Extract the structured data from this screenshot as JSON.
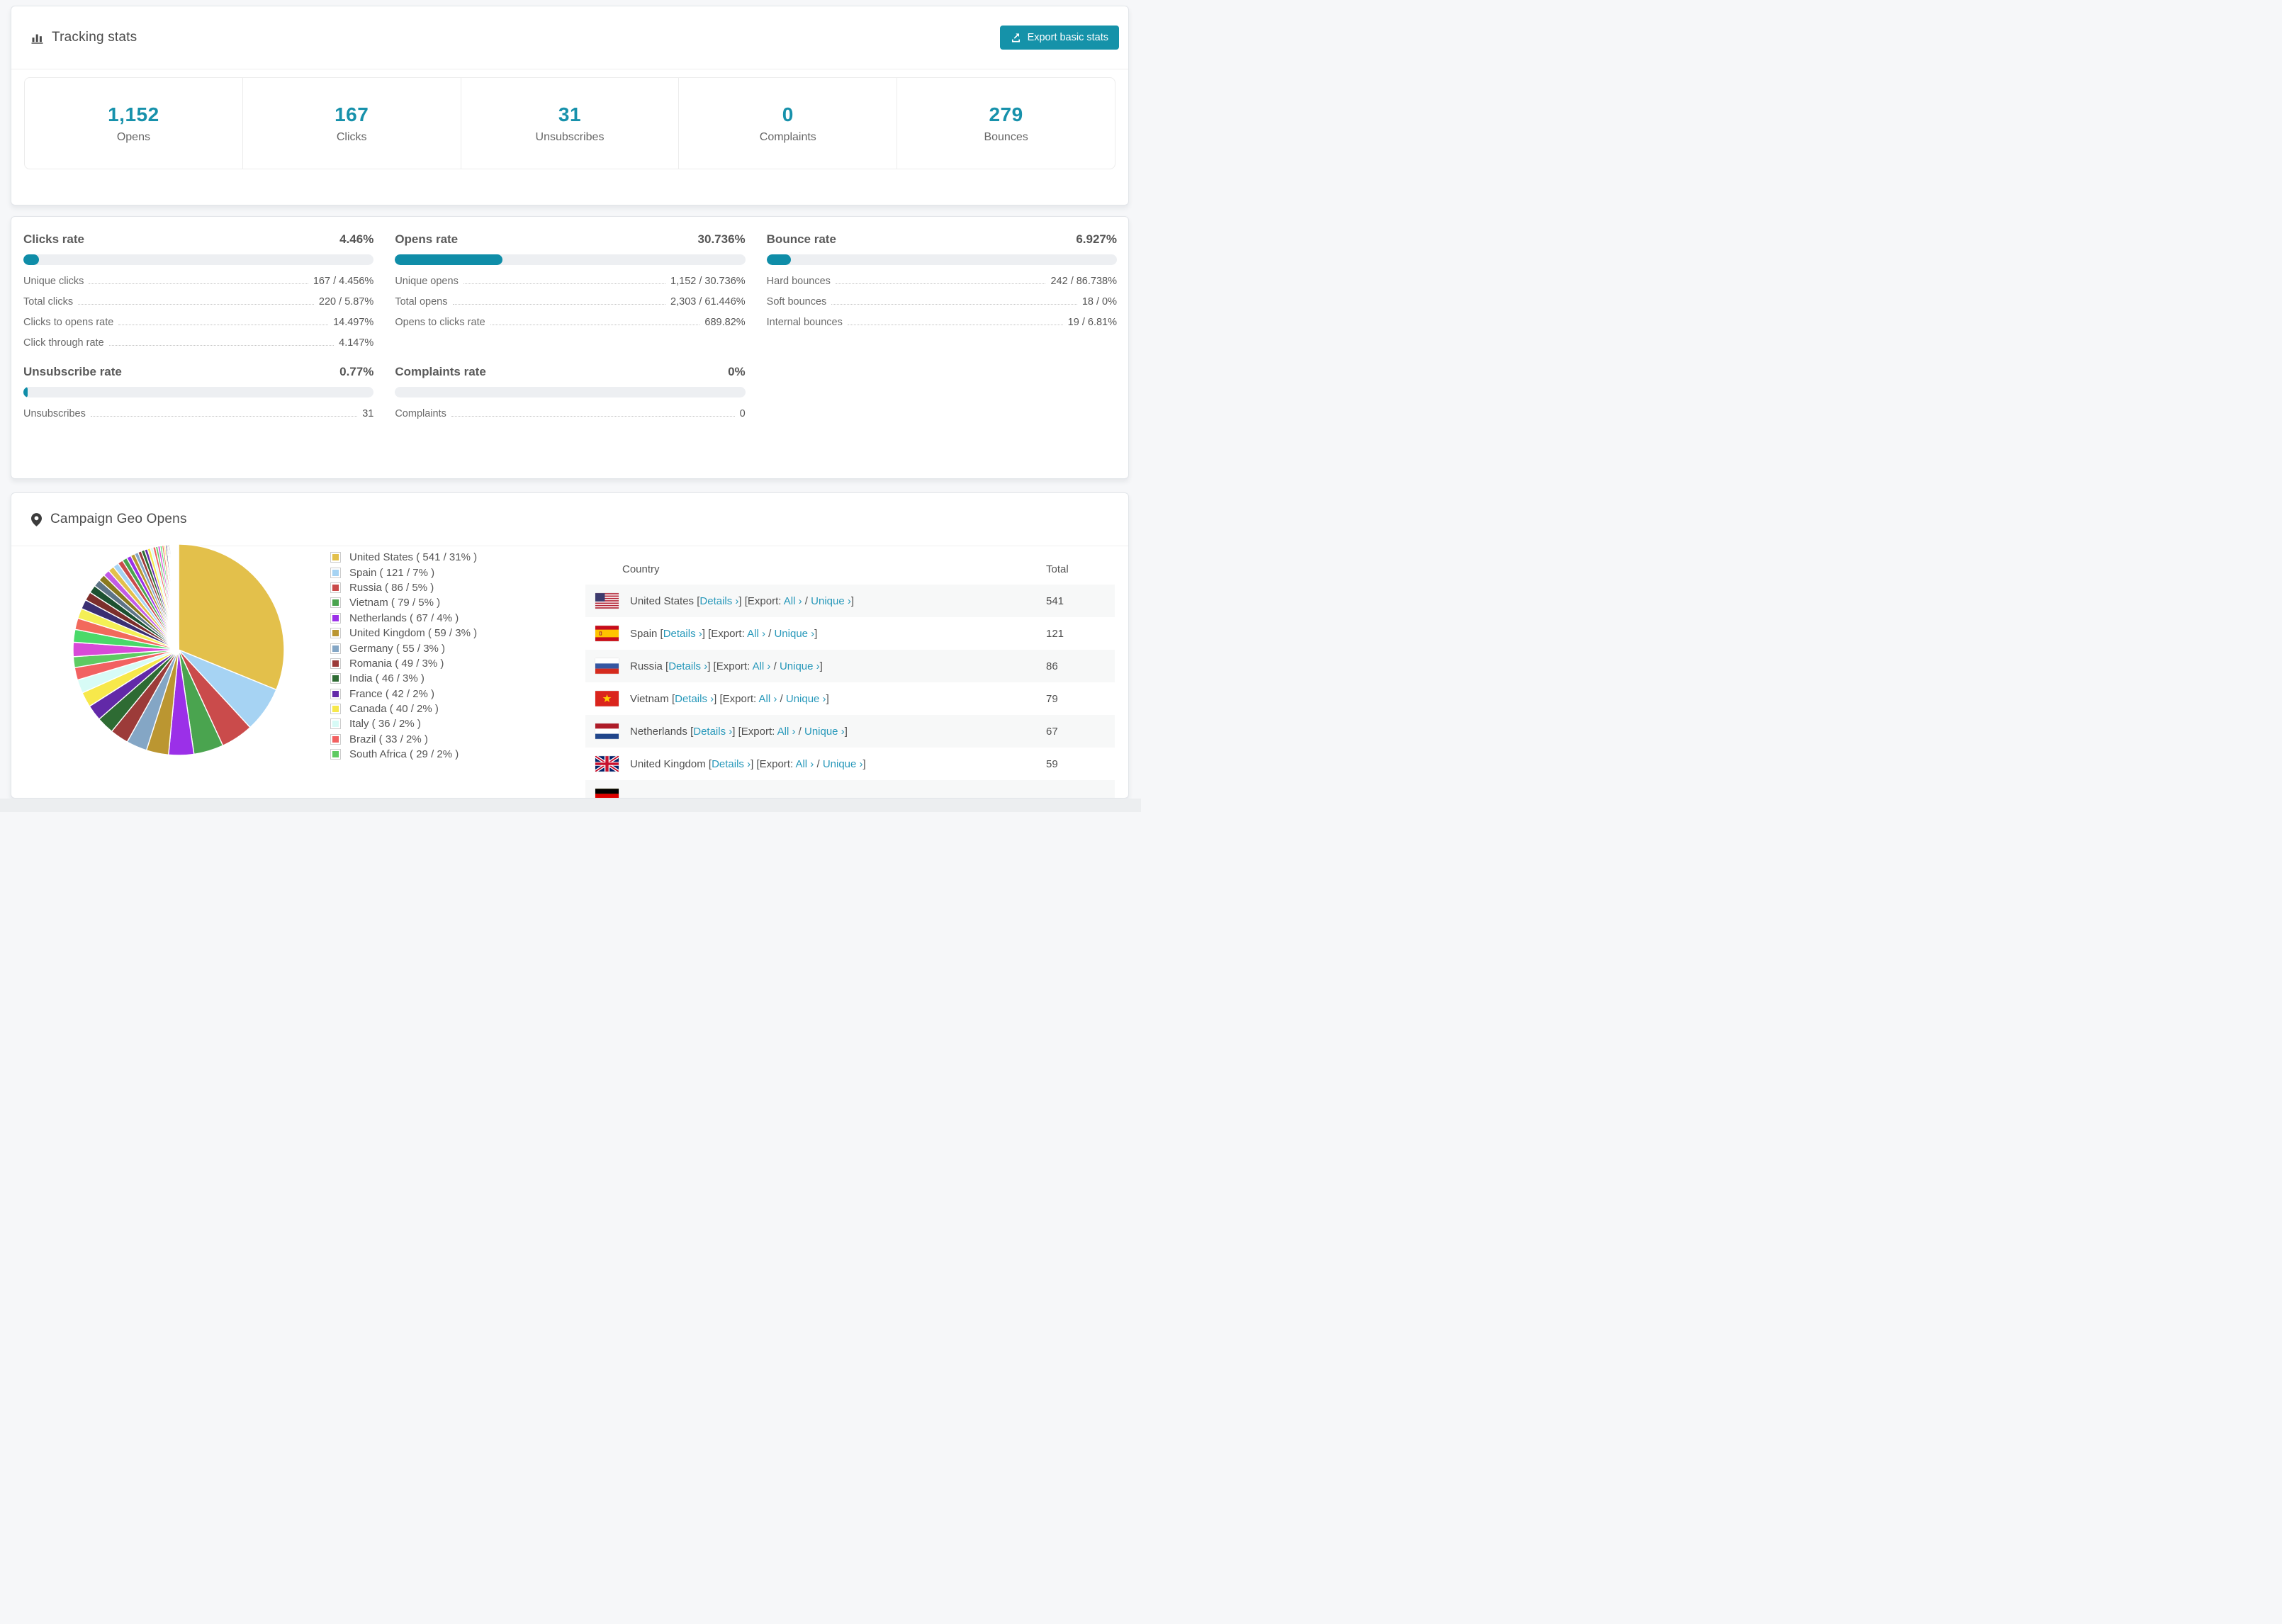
{
  "colors": {
    "accent": "#1791ab",
    "accent_bar": "#0f8da8",
    "button_bg": "#1592a9",
    "link": "#2798ba",
    "bar_track": "#edeff2",
    "row_alt_bg": "#f7f8f8"
  },
  "tracking": {
    "title": "Tracking stats",
    "export_button": "Export basic stats",
    "summary": [
      {
        "value": "1,152",
        "label": "Opens"
      },
      {
        "value": "167",
        "label": "Clicks"
      },
      {
        "value": "31",
        "label": "Unsubscribes"
      },
      {
        "value": "0",
        "label": "Complaints"
      },
      {
        "value": "279",
        "label": "Bounces"
      }
    ]
  },
  "rates": [
    {
      "title": "Clicks rate",
      "value": "4.46%",
      "percent": 4.46,
      "rows": [
        {
          "label": "Unique clicks",
          "value": "167 / 4.456%"
        },
        {
          "label": "Total clicks",
          "value": "220 / 5.87%"
        },
        {
          "label": "Clicks to opens rate",
          "value": "14.497%"
        },
        {
          "label": "Click through rate",
          "value": "4.147%"
        }
      ]
    },
    {
      "title": "Opens rate",
      "value": "30.736%",
      "percent": 30.736,
      "rows": [
        {
          "label": "Unique opens",
          "value": "1,152 / 30.736%"
        },
        {
          "label": "Total opens",
          "value": "2,303 / 61.446%"
        },
        {
          "label": "Opens to clicks rate",
          "value": "689.82%"
        }
      ]
    },
    {
      "title": "Bounce rate",
      "value": "6.927%",
      "percent": 6.927,
      "rows": [
        {
          "label": "Hard bounces",
          "value": "242 / 86.738%"
        },
        {
          "label": "Soft bounces",
          "value": "18 / 0%"
        },
        {
          "label": "Internal bounces",
          "value": "19 / 6.81%"
        }
      ]
    },
    {
      "title": "Unsubscribe rate",
      "value": "0.77%",
      "percent": 0.77,
      "rows": [
        {
          "label": "Unsubscribes",
          "value": "31"
        }
      ]
    },
    {
      "title": "Complaints rate",
      "value": "0%",
      "percent": 0,
      "rows": [
        {
          "label": "Complaints",
          "value": "0"
        }
      ]
    }
  ],
  "geo": {
    "title": "Campaign Geo Opens",
    "table": {
      "col_country": "Country",
      "col_total": "Total",
      "details_label": "Details ›",
      "export_label": "Export:",
      "all_label": "All ›",
      "unique_label": "Unique ›",
      "rows": [
        {
          "flag": "us",
          "country": "United States",
          "total": "541",
          "partial": false
        },
        {
          "flag": "es",
          "country": "Spain",
          "total": "121",
          "partial": false
        },
        {
          "flag": "ru",
          "country": "Russia",
          "total": "86",
          "partial": false
        },
        {
          "flag": "vn",
          "country": "Vietnam",
          "total": "79",
          "partial": false
        },
        {
          "flag": "nl",
          "country": "Netherlands",
          "total": "67",
          "partial": false
        },
        {
          "flag": "gb",
          "country": "United Kingdom",
          "total": "59",
          "partial": false
        },
        {
          "flag": "de",
          "country": "",
          "total": "",
          "partial": true
        }
      ]
    }
  },
  "chart_data": {
    "type": "pie",
    "title": "Campaign Geo Opens",
    "legend_position": "right-of-pie",
    "start_angle_deg": -90,
    "direction": "clockwise",
    "slices": [
      {
        "label": "United States",
        "value": 541,
        "pct": "31%"
      },
      {
        "label": "Spain",
        "value": 121,
        "pct": "7%"
      },
      {
        "label": "Russia",
        "value": 86,
        "pct": "5%"
      },
      {
        "label": "Vietnam",
        "value": 79,
        "pct": "5%"
      },
      {
        "label": "Netherlands",
        "value": 67,
        "pct": "4%"
      },
      {
        "label": "United Kingdom",
        "value": 59,
        "pct": "3%"
      },
      {
        "label": "Germany",
        "value": 55,
        "pct": "3%"
      },
      {
        "label": "Romania",
        "value": 49,
        "pct": "3%"
      },
      {
        "label": "India",
        "value": 46,
        "pct": "3%"
      },
      {
        "label": "France",
        "value": 42,
        "pct": "2%"
      },
      {
        "label": "Canada",
        "value": 40,
        "pct": "2%"
      },
      {
        "label": "Italy",
        "value": 36,
        "pct": "2%"
      },
      {
        "label": "Brazil",
        "value": 33,
        "pct": "2%"
      },
      {
        "label": "South Africa",
        "value": 29,
        "pct": "2%"
      }
    ],
    "other_unlabeled_slices_estimated": [
      38,
      34,
      30,
      27,
      25,
      23,
      21,
      19,
      18,
      17,
      16,
      15,
      14,
      13,
      12,
      11,
      10,
      9,
      9,
      8,
      8,
      7,
      7,
      6,
      6,
      5,
      5,
      4,
      4,
      3,
      3,
      3,
      2,
      2,
      2,
      2,
      1,
      1,
      1,
      1,
      1,
      1,
      1,
      1,
      1,
      1,
      1,
      1,
      1,
      1
    ],
    "palette": [
      "#e3c04b",
      "#a6d3f3",
      "#ca4b4b",
      "#4aa44f",
      "#9b30e8",
      "#bb9631",
      "#84a6c5",
      "#9c3b39",
      "#2e6b33",
      "#6229a8",
      "#f7e84b",
      "#d7fbf6",
      "#f26161",
      "#5ecb62",
      "#d84ad8",
      "#49d969",
      "#f2695c",
      "#f4ef55",
      "#3b2f72",
      "#7c2e2b",
      "#1c5130",
      "#5d7486",
      "#8a7a1f",
      "#c25ae8"
    ]
  }
}
